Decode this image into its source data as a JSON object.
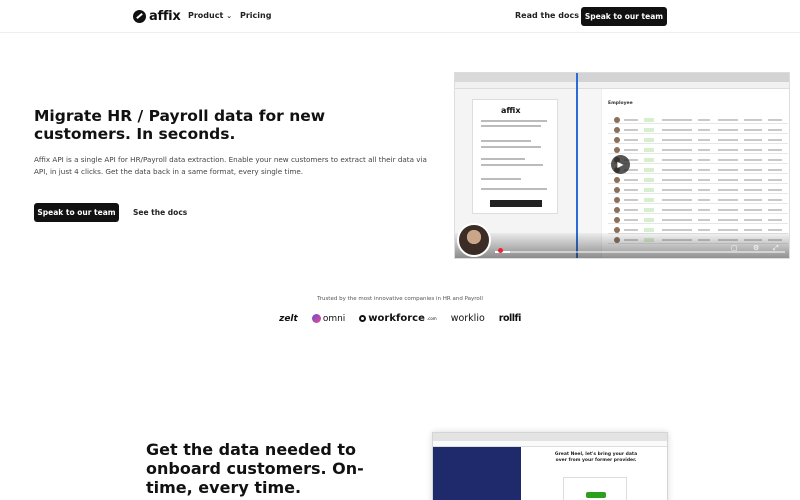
{
  "nav": {
    "brand": "affix",
    "product_label": "Product",
    "pricing_label": "Pricing",
    "docs_label": "Read the docs",
    "cta_label": "Speak to our team"
  },
  "hero": {
    "title": "Migrate HR / Payroll data for new customers. In seconds.",
    "description": "Affix API is a single API for HR/Payroll data extraction. Enable your new customers to extract all their data via API, in just 4 clicks. Get the data back in a same format, every single time.",
    "primary_cta": "Speak to our team",
    "secondary_cta": "See the docs"
  },
  "video": {
    "card_brand": "affix",
    "heading": "Employee",
    "progress": 0.05
  },
  "trusted": {
    "caption": "Trusted by the most innovative companies in HR and Payroll",
    "logos": [
      "zelt",
      "omni",
      "workforce",
      "worklio",
      "rollfi"
    ],
    "workforce_suffix": ".com"
  },
  "section2": {
    "title": "Get the data needed to onboard customers. On-time, every time.",
    "screenshot_text": "Great Neel, let's bring your data over from your former provider."
  }
}
